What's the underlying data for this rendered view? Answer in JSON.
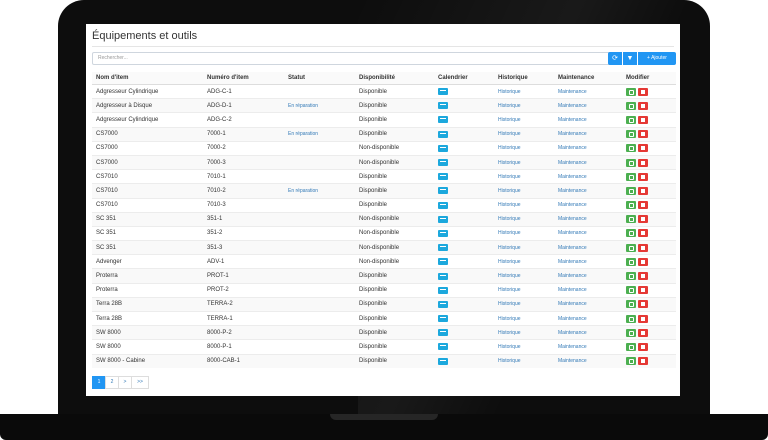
{
  "page": {
    "title": "Équipements et outils"
  },
  "toolbar": {
    "search_placeholder": "Rechercher...",
    "refresh_icon": "⟳",
    "filter_icon": "▼",
    "add_label": "+ Ajouter"
  },
  "table": {
    "headers": [
      "Nom d'item",
      "Numéro d'item",
      "Statut",
      "Disponibilité",
      "Calendrier",
      "Historique",
      "Maintenance",
      "Modifier"
    ],
    "history_label": "Historique",
    "maintenance_label": "Maintenance",
    "rows": [
      {
        "name": "Adgresseur Cylindrique",
        "number": "ADG-C-1",
        "status": "",
        "availability": "Disponible"
      },
      {
        "name": "Adgresseur à Disque",
        "number": "ADG-D-1",
        "status": "En réparation",
        "availability": "Disponible"
      },
      {
        "name": "Adgresseur Cylindrique",
        "number": "ADG-C-2",
        "status": "",
        "availability": "Disponible"
      },
      {
        "name": "CS7000",
        "number": "7000-1",
        "status": "En réparation",
        "availability": "Disponible"
      },
      {
        "name": "CS7000",
        "number": "7000-2",
        "status": "",
        "availability": "Non-disponible"
      },
      {
        "name": "CS7000",
        "number": "7000-3",
        "status": "",
        "availability": "Non-disponible"
      },
      {
        "name": "CS7010",
        "number": "7010-1",
        "status": "",
        "availability": "Disponible"
      },
      {
        "name": "CS7010",
        "number": "7010-2",
        "status": "En réparation",
        "availability": "Disponible"
      },
      {
        "name": "CS7010",
        "number": "7010-3",
        "status": "",
        "availability": "Disponible"
      },
      {
        "name": "SC 351",
        "number": "351-1",
        "status": "",
        "availability": "Non-disponible"
      },
      {
        "name": "SC 351",
        "number": "351-2",
        "status": "",
        "availability": "Non-disponible"
      },
      {
        "name": "SC 351",
        "number": "351-3",
        "status": "",
        "availability": "Non-disponible"
      },
      {
        "name": "Advenger",
        "number": "ADV-1",
        "status": "",
        "availability": "Non-disponible"
      },
      {
        "name": "Proterra",
        "number": "PROT-1",
        "status": "",
        "availability": "Disponible"
      },
      {
        "name": "Proterra",
        "number": "PROT-2",
        "status": "",
        "availability": "Disponible"
      },
      {
        "name": "Terra 28B",
        "number": "TERRA-2",
        "status": "",
        "availability": "Disponible"
      },
      {
        "name": "Terra 28B",
        "number": "TERRA-1",
        "status": "",
        "availability": "Disponible"
      },
      {
        "name": "SW 8000",
        "number": "8000-P-2",
        "status": "",
        "availability": "Disponible"
      },
      {
        "name": "SW 8000",
        "number": "8000-P-1",
        "status": "",
        "availability": "Disponible"
      },
      {
        "name": "SW 8000 - Cabine",
        "number": "8000-CAB-1",
        "status": "",
        "availability": "Disponible"
      }
    ]
  },
  "pagination": {
    "pages": [
      "1",
      "2",
      ">",
      ">>"
    ],
    "active": "1"
  },
  "colors": {
    "primary": "#2196f3",
    "edit": "#4caf50",
    "delete": "#e53935",
    "calendar": "#1ca8dd",
    "link": "#337ab7"
  }
}
